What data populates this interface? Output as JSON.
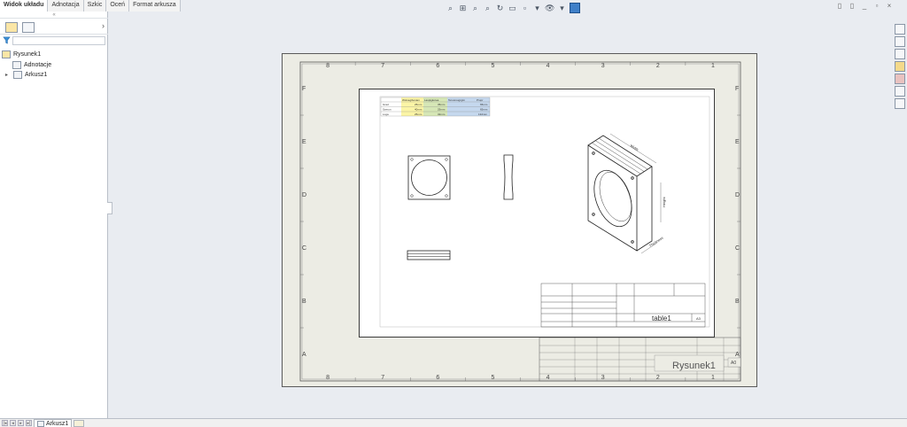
{
  "command_tabs": [
    "Widok układu",
    "Adnotacja",
    "Szkic",
    "Oceń",
    "Format arkusza"
  ],
  "active_tab_index": 0,
  "feature_tree": {
    "root": "Rysunek1",
    "children": [
      {
        "label": "Adnotacje"
      },
      {
        "label": "Arkusz1"
      }
    ]
  },
  "sheet": {
    "zone_columns": [
      "8",
      "7",
      "6",
      "5",
      "4",
      "3",
      "2",
      "1"
    ],
    "zone_rows": [
      "F",
      "E",
      "D",
      "C",
      "B",
      "A"
    ],
    "title_block": {
      "drawing_title": "Rysunek1",
      "sheet_size": "A0"
    }
  },
  "inner_drawing": {
    "table_headers": [
      "Wolnegibonam",
      "Laspigkorea",
      "Terosrougrgim",
      "Prupr"
    ],
    "table_rows": [
      {
        "label": "Grad",
        "values": [
          "25mm",
          "35mm",
          "",
          "65mm"
        ]
      },
      {
        "label": "Szerun",
        "values": [
          "40mm",
          "25mm",
          "",
          "65mm"
        ]
      },
      {
        "label": "Loga",
        "values": [
          "25mm",
          "32mm",
          "",
          "132mm"
        ]
      }
    ],
    "dim_width": "Width",
    "dim_height": "Height",
    "dim_thickness": "Thickness",
    "title_label": "table1",
    "sheet_size": "A3"
  },
  "sheet_tabs": {
    "tabs": [
      "Arkusz1"
    ]
  },
  "colors": {
    "yellow_col": "#fbf5a6",
    "green_col": "#d6e7b6",
    "blue_col": "#c5d8ee",
    "hud_accent": "#3f7fc8"
  }
}
